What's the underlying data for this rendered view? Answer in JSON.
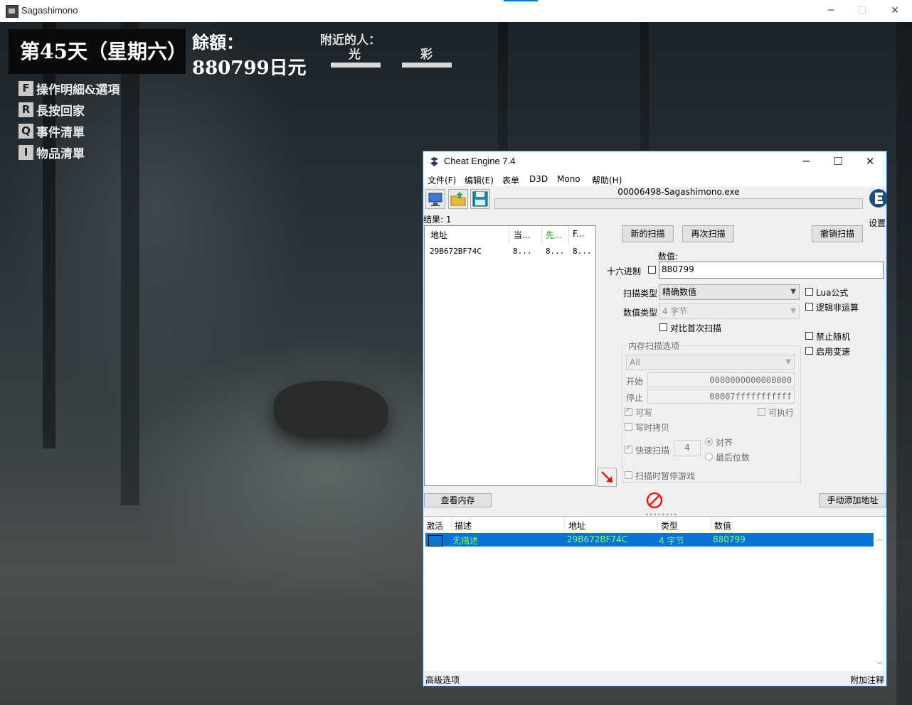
{
  "game": {
    "window_title": "Sagashimono",
    "day": "第45天（星期六）",
    "balance_label": "餘額：",
    "balance_value": "880799日元",
    "nearby_label": "附近的人：",
    "nearby": [
      "光",
      "彩"
    ],
    "hints": [
      {
        "key": "F",
        "text": "操作明細&選項"
      },
      {
        "key": "R",
        "text": "長按回家"
      },
      {
        "key": "Q",
        "text": "事件清單"
      },
      {
        "key": "I",
        "text": "物品清單"
      }
    ]
  },
  "ce": {
    "title": "Cheat Engine 7.4",
    "menu": [
      "文件(F)",
      "编辑(E)",
      "表单",
      "D3D",
      "Mono",
      "帮助(H)"
    ],
    "process": "00006498-Sagashimono.exe",
    "settings": "设置",
    "results_count": "结果: 1",
    "results_headers": [
      "地址",
      "当...",
      "先...",
      "F..."
    ],
    "results_rows": [
      {
        "addr": "29B672BF74C",
        "cur": "8...",
        "prev": "8...",
        "first": "8..."
      }
    ],
    "buttons": {
      "new_scan": "新的扫描",
      "next_scan": "再次扫描",
      "undo_scan": "撤销扫描",
      "view_memory": "查看内存",
      "add_manual": "手动添加地址"
    },
    "value_label": "数值:",
    "hex_label": "十六进制",
    "value": "880799",
    "scan_type_label": "扫描类型",
    "scan_type": "精确数值",
    "value_type_label": "数值类型",
    "value_type": "4 字节",
    "compare_first": "对比首次扫描",
    "lua_formula": "Lua公式",
    "logical_not": "逻辑非运算",
    "no_random": "禁止随机",
    "speedhack": "启用变速",
    "mem_options_title": "内存扫描选项",
    "mem_region": "All",
    "start_label": "开始",
    "start_value": "0000000000000000",
    "stop_label": "停止",
    "stop_value": "00007fffffffffff",
    "writable": "可写",
    "executable": "可执行",
    "copy_on_write": "写时拷贝",
    "fast_scan": "快速扫描",
    "fast_scan_value": "4",
    "alignment": "对齐",
    "last_digits": "最后位数",
    "pause_game": "扫描时暂停游戏",
    "table_headers": [
      "激活",
      "描述",
      "地址",
      "类型",
      "数值"
    ],
    "table_rows": [
      {
        "desc": "无描述",
        "addr": "29B672BF74C",
        "type": "4 字节",
        "value": "880799"
      }
    ],
    "footer_left": "高级选项",
    "footer_right": "附加注释",
    "colors": {
      "selection": "#0a74d6",
      "row_text": "#7dff6a",
      "accent": "#2d6fb3"
    }
  }
}
